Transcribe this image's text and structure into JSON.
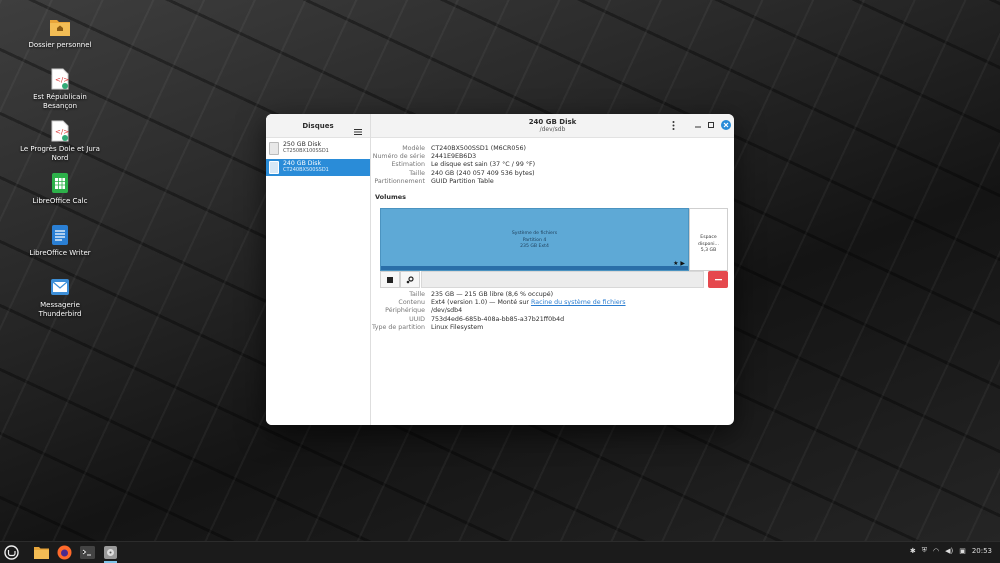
{
  "desktop": {
    "icons": [
      {
        "label": "Dossier personnel",
        "icon": "folder-home-icon"
      },
      {
        "label": "Est Républicain Besançon",
        "icon": "html-file-icon"
      },
      {
        "label": "Le Progrès Dole et Jura Nord",
        "icon": "html-file-icon"
      },
      {
        "label": "LibreOffice Calc",
        "icon": "calc-icon"
      },
      {
        "label": "LibreOffice Writer",
        "icon": "writer-icon"
      },
      {
        "label": "Messagerie Thunderbird",
        "icon": "mail-icon"
      }
    ]
  },
  "window": {
    "sidebar": {
      "title": "Disques",
      "disks": [
        {
          "name": "250 GB Disk",
          "model": "CT250BX100SSD1",
          "selected": false
        },
        {
          "name": "240 GB Disk",
          "model": "CT240BX500SSD1",
          "selected": true
        }
      ]
    },
    "header": {
      "title": "240 GB Disk",
      "subtitle": "/dev/sdb"
    },
    "disk_props": [
      {
        "key": "Modèle",
        "value": "CT240BX500SSD1 (M6CR056)"
      },
      {
        "key": "Numéro de série",
        "value": "2441E9EB6D3"
      },
      {
        "key": "Estimation",
        "value": "Le disque est sain (37 °C / 99 °F)"
      },
      {
        "key": "Taille",
        "value": "240 GB (240 057 409 536 bytes)"
      },
      {
        "key": "Partitionnement",
        "value": "GUID Partition Table"
      }
    ],
    "volumes_title": "Volumes",
    "partition": {
      "line1": "Système de fichiers",
      "line2": "Partition 4",
      "line3": "235 GB Ext4",
      "free_line1": "Espace disponi...",
      "free_line2": "5,3 GB"
    },
    "volume_props": {
      "size_key": "Taille",
      "size_value": "235 GB — 215 GB libre (8,6 % occupé)",
      "content_key": "Contenu",
      "content_prefix": "Ext4 (version 1.0) — Monté sur ",
      "content_link": "Racine du système de fichiers",
      "device_key": "Périphérique",
      "device_value": "/dev/sdb4",
      "uuid_key": "UUID",
      "uuid_value": "753d4ed6-685b-408a-bb85-a37b21ff0b4d",
      "type_key": "Type de partition",
      "type_value": "Linux Filesystem"
    }
  },
  "taskbar": {
    "clock": "20:53",
    "accent": "#7ec3e8"
  }
}
